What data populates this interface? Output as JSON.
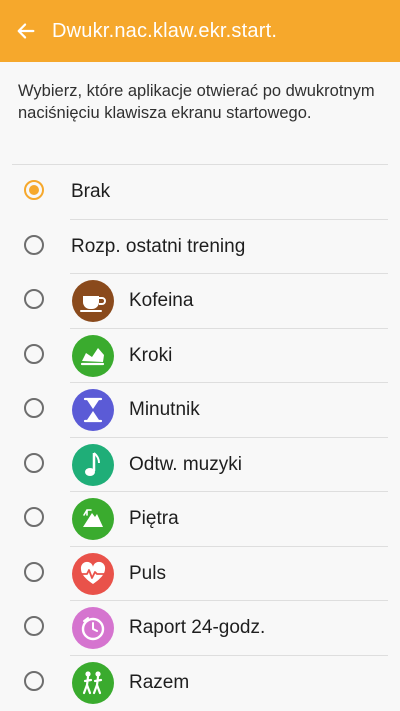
{
  "header": {
    "back_icon": "arrow-left-icon",
    "title": "Dwukr.nac.klaw.ekr.start."
  },
  "description": "Wybierz, które aplikacje otwierać po dwukrotnym naciśnięciu klawisza ekranu startowego.",
  "colors": {
    "accent": "#f6a82c"
  },
  "options": [
    {
      "label": "Brak",
      "selected": true
    },
    {
      "label": "Rozp. ostatni trening",
      "selected": false
    },
    {
      "label": "Kofeina",
      "icon": "coffee-cup-icon",
      "icon_color": "#8a4a1c",
      "selected": false
    },
    {
      "label": "Kroki",
      "icon": "shoe-icon",
      "icon_color": "#3aab2e",
      "selected": false
    },
    {
      "label": "Minutnik",
      "icon": "hourglass-icon",
      "icon_color": "#5b5bd6",
      "selected": false
    },
    {
      "label": "Odtw. muzyki",
      "icon": "music-note-icon",
      "icon_color": "#1fae78",
      "selected": false
    },
    {
      "label": "Piętra",
      "icon": "mountain-icon",
      "icon_color": "#3aab2e",
      "selected": false
    },
    {
      "label": "Puls",
      "icon": "heart-pulse-icon",
      "icon_color": "#e9524a",
      "selected": false
    },
    {
      "label": "Raport 24-godz.",
      "icon": "timer-report-icon",
      "icon_color": "#d574cf",
      "selected": false
    },
    {
      "label": "Razem",
      "icon": "walking-people-icon",
      "icon_color": "#3aab2e",
      "selected": false
    }
  ]
}
